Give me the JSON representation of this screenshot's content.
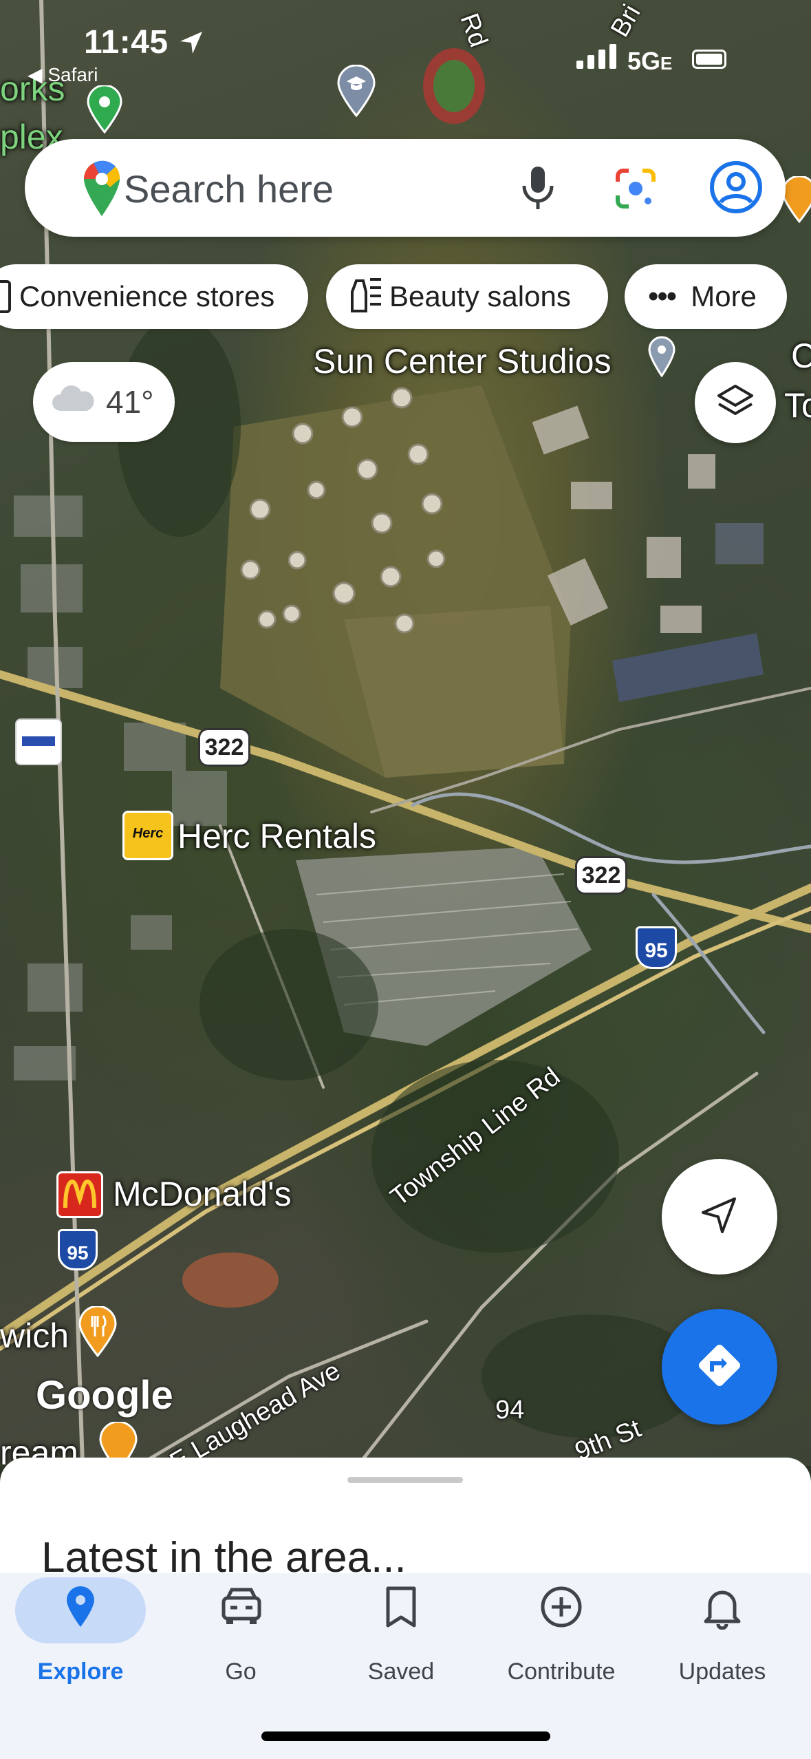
{
  "status_bar": {
    "time": "11:45",
    "back_app": "◀ Safari",
    "network": "5G",
    "network_suffix": "E"
  },
  "search": {
    "placeholder": "Search here"
  },
  "chips": [
    {
      "label": "Convenience stores",
      "icon": "convenience-store-icon"
    },
    {
      "label": "Beauty salons",
      "icon": "beauty-salon-icon"
    },
    {
      "label": "More",
      "icon": "more-dots-icon"
    }
  ],
  "weather": {
    "temperature": "41°",
    "icon": "cloud-icon"
  },
  "map": {
    "places": {
      "sun_center": "Sun Center Studios",
      "herc": "Herc Rentals",
      "mcdonalds": "McDonald's",
      "wich": "wich",
      "ream": "ream",
      "orks": "orks",
      "plex": "plex",
      "to": "To",
      "c": "C"
    },
    "roads": {
      "township": "Township Line Rd",
      "laughead": "E Laughead Ave",
      "ninth": "9th St",
      "rd": "Rd",
      "bri": "Bri",
      "num94": "94"
    },
    "shields": {
      "us322_a": "322",
      "us322_b": "322",
      "i95_a": "95",
      "i95_b": "95"
    },
    "herc_logo": "Herc",
    "attribution": "Google"
  },
  "sheet": {
    "title": "Latest in the area..."
  },
  "nav": {
    "items": [
      {
        "label": "Explore",
        "icon": "location-pin-icon",
        "active": true
      },
      {
        "label": "Go",
        "icon": "car-icon"
      },
      {
        "label": "Saved",
        "icon": "bookmark-icon"
      },
      {
        "label": "Contribute",
        "icon": "add-circle-icon"
      },
      {
        "label": "Updates",
        "icon": "bell-icon"
      }
    ]
  },
  "colors": {
    "accent_blue": "#1a73e8",
    "nav_active": "#c7dbf8",
    "nav_bg": "#f0f3fa"
  }
}
